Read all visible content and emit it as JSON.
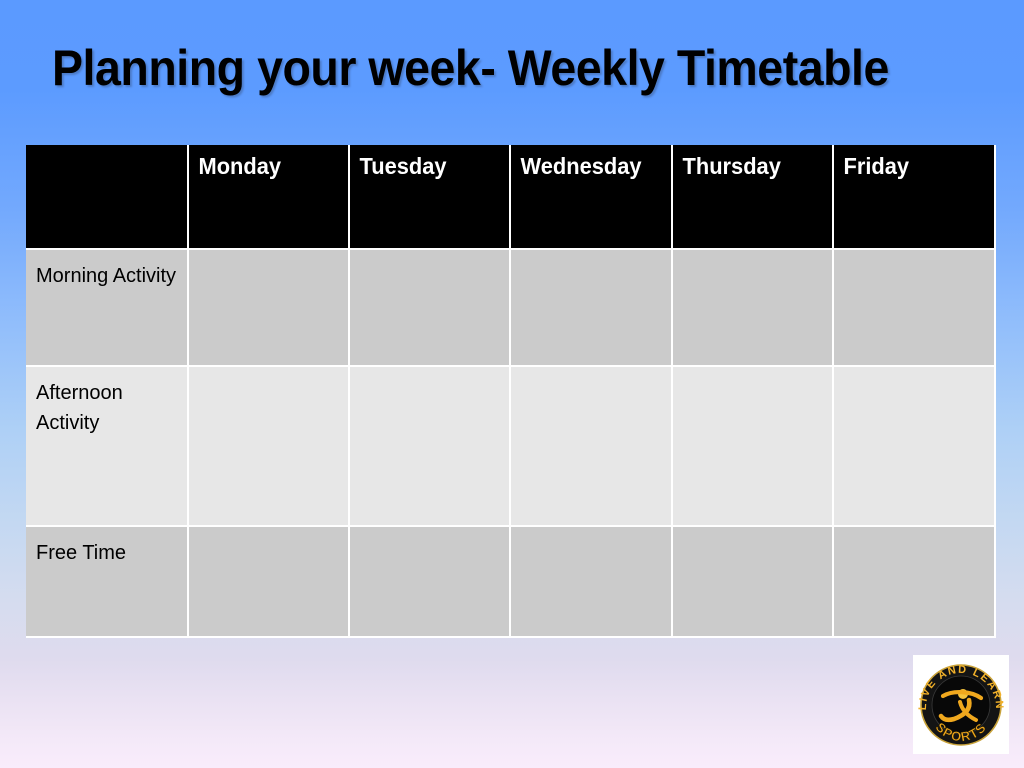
{
  "slide": {
    "title": "Planning your week- Weekly Timetable",
    "background": {
      "top_color": "#5c9bff",
      "bottom_color": "#f9ecfb"
    }
  },
  "table": {
    "corner_label": "",
    "columns": [
      {
        "key": "label",
        "header": ""
      },
      {
        "key": "monday",
        "header": "Monday"
      },
      {
        "key": "tuesday",
        "header": "Tuesday"
      },
      {
        "key": "wednesday",
        "header": "Wednesday"
      },
      {
        "key": "thursday",
        "header": "Thursday"
      },
      {
        "key": "friday",
        "header": "Friday"
      }
    ],
    "header_background": "#000000",
    "header_text_color": "#ffffff",
    "rows": [
      {
        "label": "Morning Activity",
        "row_background": "#cbcbcb",
        "cells": [
          "",
          "",
          "",
          "",
          ""
        ]
      },
      {
        "label": "Afternoon Activity",
        "row_background": "#e7e7e7",
        "cells": [
          "",
          "",
          "",
          "",
          ""
        ]
      },
      {
        "label": "Free Time",
        "row_background": "#cbcbcb",
        "cells": [
          "",
          "",
          "",
          "",
          ""
        ]
      }
    ]
  },
  "logo": {
    "name": "live-and-learn-sports-logo",
    "arc_text": "LIVE AND LEARN",
    "bottom_text": "SPORTS",
    "gold_color": "#f0a81e",
    "disc_color": "#0a0a0a"
  }
}
